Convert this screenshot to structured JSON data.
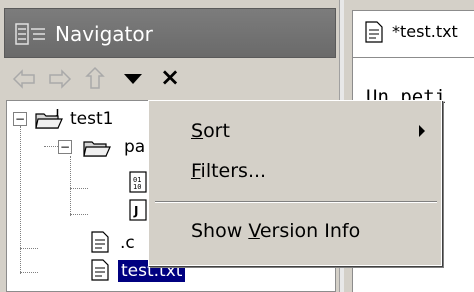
{
  "navigator": {
    "title": "Navigator",
    "toolbar": {
      "back_icon": "back-arrow-icon",
      "forward_icon": "forward-arrow-icon",
      "up_icon": "up-arrow-icon",
      "menu_icon": "view-menu-icon",
      "close_glyph": "×"
    },
    "tree": {
      "project": {
        "label": "test1",
        "expander": "−"
      },
      "folder": {
        "label": "pa",
        "expander": "−"
      },
      "file_c": {
        "label": ".c"
      },
      "file_txt": {
        "label": "test.txt"
      }
    }
  },
  "editor": {
    "tab_label": "*test.txt",
    "content": "Un peti"
  },
  "context_menu": {
    "items": [
      {
        "prefix": "",
        "mnemonic": "S",
        "suffix": "ort",
        "has_submenu": true
      },
      {
        "prefix": "",
        "mnemonic": "F",
        "suffix": "ilters...",
        "has_submenu": false
      },
      {
        "prefix": "Show ",
        "mnemonic": "V",
        "suffix": "ersion Info",
        "has_submenu": false
      }
    ]
  },
  "colors": {
    "titlebar": "#6a6a6a",
    "selection": "#000080",
    "menu_bg": "#d4d0c8"
  }
}
